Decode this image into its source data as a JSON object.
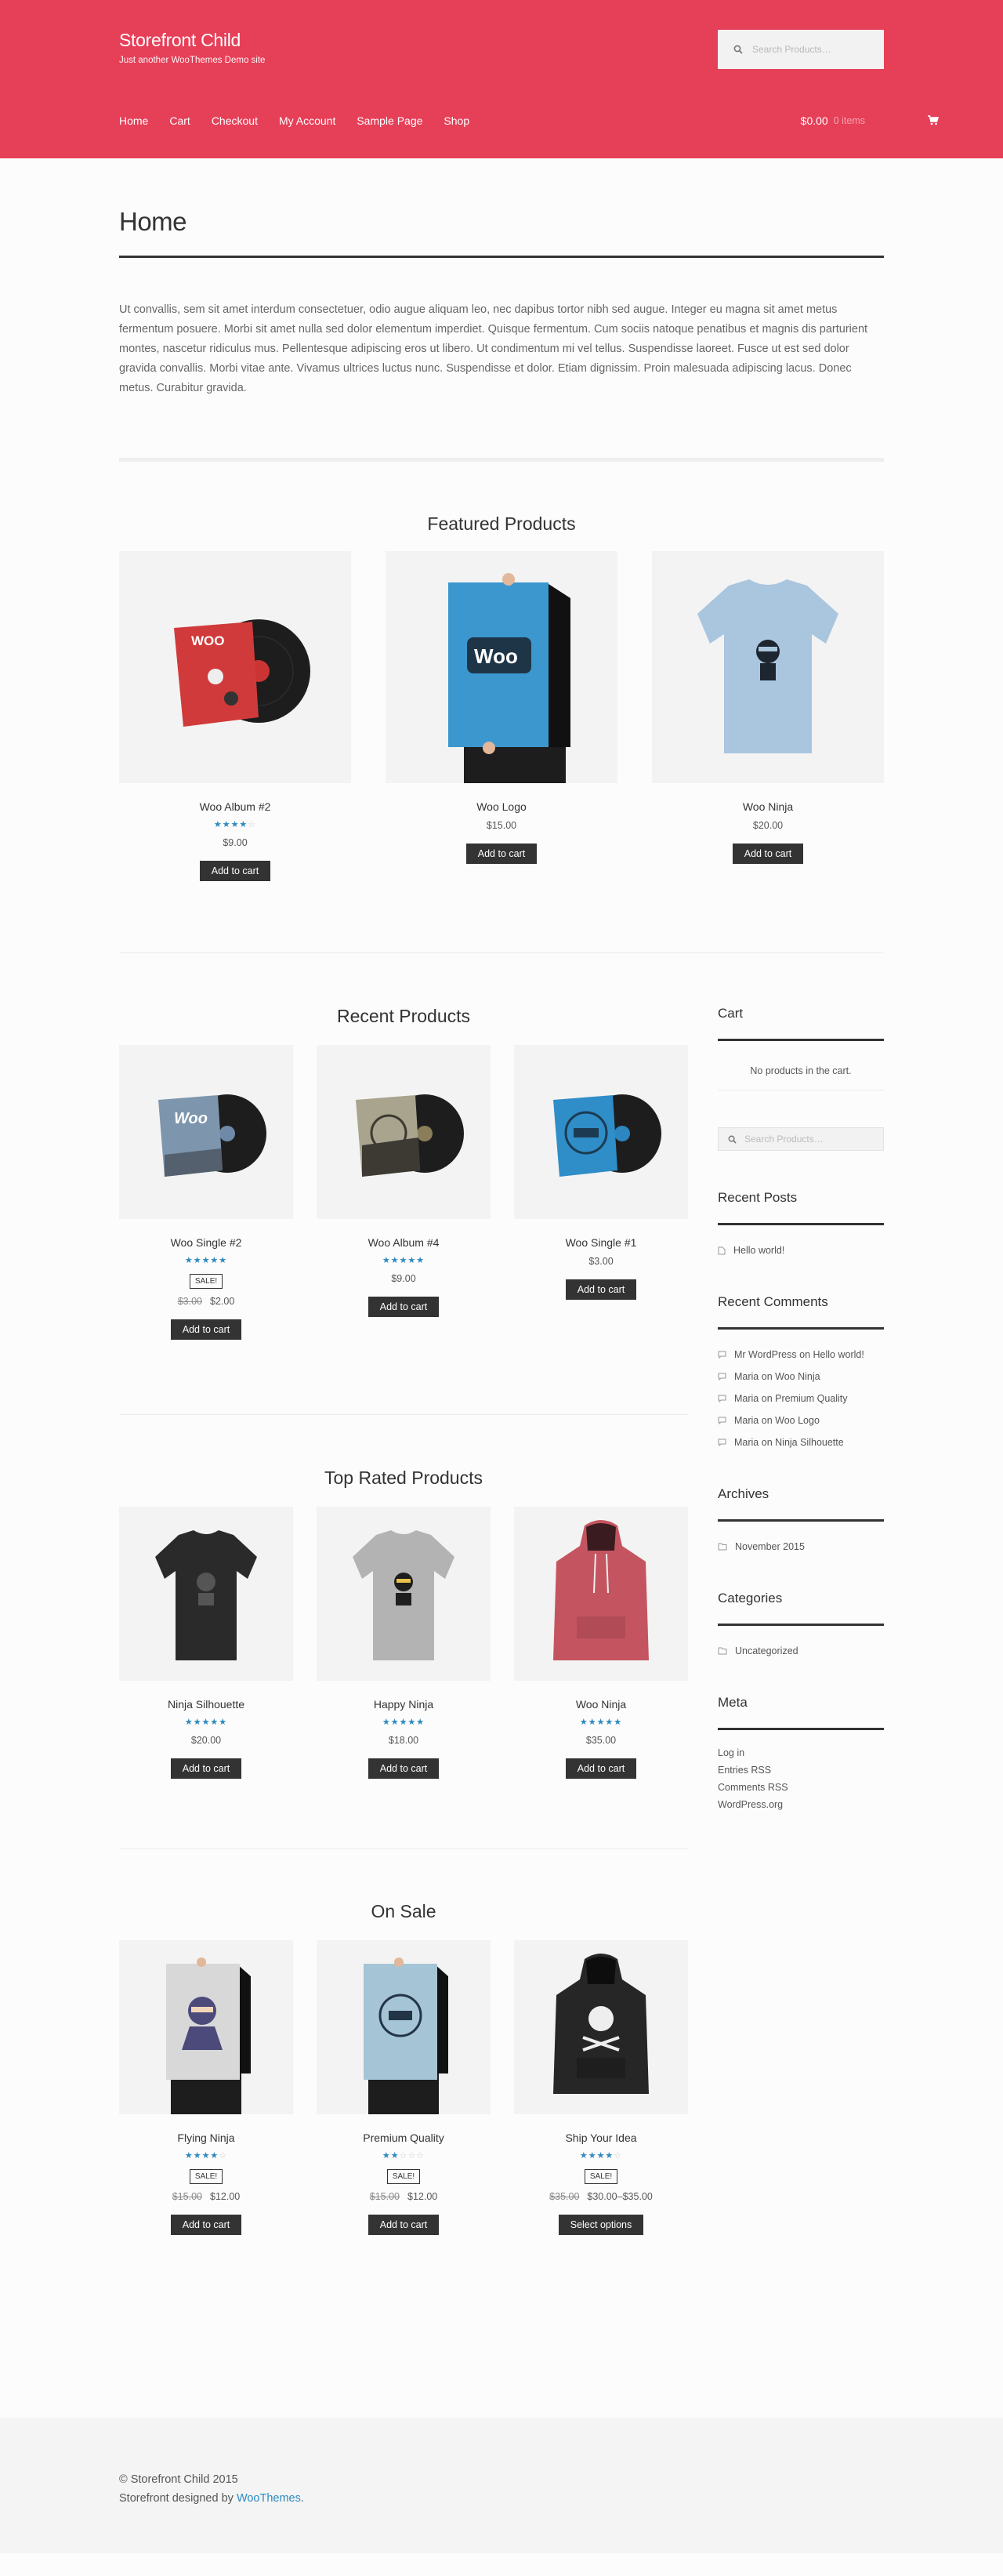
{
  "header": {
    "site_title": "Storefront Child",
    "site_description": "Just another WooThemes Demo site",
    "search_placeholder": "Search Products…",
    "nav": [
      "Home",
      "Cart",
      "Checkout",
      "My Account",
      "Sample Page",
      "Shop"
    ],
    "cart_total": "$0.00",
    "cart_count": "0 items",
    "brand_color": "#e63f58"
  },
  "page": {
    "title": "Home",
    "intro": "Ut convallis, sem sit amet interdum consectetuer, odio augue aliquam leo, nec dapibus tortor nibh sed augue. Integer eu magna sit amet metus fermentum posuere. Morbi sit amet nulla sed dolor elementum imperdiet. Quisque fermentum. Cum sociis natoque penatibus et magnis dis parturient montes, nascetur ridiculus mus. Pellentesque adipiscing eros ut libero. Ut condimentum mi vel tellus. Suspendisse laoreet. Fusce ut est sed dolor gravida convallis. Morbi vitae ante. Vivamus ultrices luctus nunc. Suspendisse et dolor. Etiam dignissim. Proin malesuada adipiscing lacus. Donec metus. Curabitur gravida."
  },
  "featured": {
    "title": "Featured Products",
    "products": [
      {
        "name": "Woo Album #2",
        "rating": 4,
        "price": "$9.00",
        "button": "Add to cart"
      },
      {
        "name": "Woo Logo",
        "price": "$15.00",
        "button": "Add to cart"
      },
      {
        "name": "Woo Ninja",
        "price": "$20.00",
        "button": "Add to cart"
      }
    ]
  },
  "recent": {
    "title": "Recent Products",
    "products": [
      {
        "name": "Woo Single #2",
        "rating": 5,
        "sale": "SALE!",
        "old_price": "$3.00",
        "price": "$2.00",
        "button": "Add to cart"
      },
      {
        "name": "Woo Album #4",
        "rating": 5,
        "price": "$9.00",
        "button": "Add to cart"
      },
      {
        "name": "Woo Single #1",
        "price": "$3.00",
        "button": "Add to cart"
      }
    ]
  },
  "top_rated": {
    "title": "Top Rated Products",
    "products": [
      {
        "name": "Ninja Silhouette",
        "rating": 5,
        "price": "$20.00",
        "button": "Add to cart"
      },
      {
        "name": "Happy Ninja",
        "rating": 5,
        "price": "$18.00",
        "button": "Add to cart"
      },
      {
        "name": "Woo Ninja",
        "rating": 5,
        "price": "$35.00",
        "button": "Add to cart"
      }
    ]
  },
  "on_sale": {
    "title": "On Sale",
    "products": [
      {
        "name": "Flying Ninja",
        "rating": 4,
        "sale": "SALE!",
        "old_price": "$15.00",
        "price": "$12.00",
        "button": "Add to cart"
      },
      {
        "name": "Premium Quality",
        "rating": 2,
        "sale": "SALE!",
        "old_price": "$15.00",
        "price": "$12.00",
        "button": "Add to cart"
      },
      {
        "name": "Ship Your Idea",
        "rating": 4,
        "sale": "SALE!",
        "old_price": "$35.00",
        "price": "$30.00–$35.00",
        "button": "Select options"
      }
    ]
  },
  "sidebar": {
    "cart_title": "Cart",
    "cart_empty": "No products in the cart.",
    "search_placeholder": "Search Products…",
    "recent_posts_title": "Recent Posts",
    "recent_posts": [
      "Hello world!"
    ],
    "recent_comments_title": "Recent Comments",
    "recent_comments": [
      {
        "author": "Mr WordPress",
        "on": "on",
        "post": "Hello world!"
      },
      {
        "author": "Maria",
        "on": "on",
        "post": "Woo Ninja"
      },
      {
        "author": "Maria",
        "on": "on",
        "post": "Premium Quality"
      },
      {
        "author": "Maria",
        "on": "on",
        "post": "Woo Logo"
      },
      {
        "author": "Maria",
        "on": "on",
        "post": "Ninja Silhouette"
      }
    ],
    "archives_title": "Archives",
    "archives": [
      "November 2015"
    ],
    "categories_title": "Categories",
    "categories": [
      "Uncategorized"
    ],
    "meta_title": "Meta",
    "meta": [
      "Log in",
      "Entries RSS",
      "Comments RSS",
      "WordPress.org"
    ]
  },
  "footer": {
    "copyright": "© Storefront Child 2015",
    "credit_prefix": "Storefront designed by",
    "credit_link": "WooThemes",
    "credit_suffix": "."
  }
}
